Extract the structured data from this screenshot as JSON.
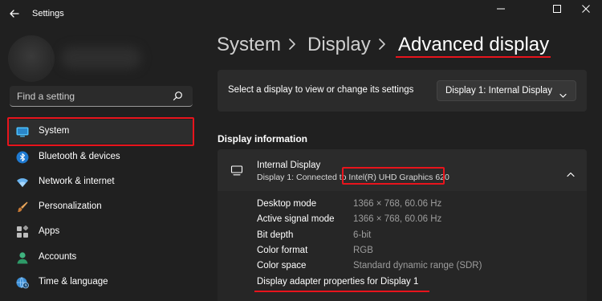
{
  "window": {
    "app_title": "Settings"
  },
  "sidebar": {
    "search_placeholder": "Find a setting",
    "items": [
      {
        "label": "System",
        "icon": "system-icon",
        "selected": true
      },
      {
        "label": "Bluetooth & devices",
        "icon": "bluetooth-icon"
      },
      {
        "label": "Network & internet",
        "icon": "wifi-icon"
      },
      {
        "label": "Personalization",
        "icon": "brush-icon"
      },
      {
        "label": "Apps",
        "icon": "apps-icon"
      },
      {
        "label": "Accounts",
        "icon": "person-icon"
      },
      {
        "label": "Time & language",
        "icon": "globe-clock-icon"
      }
    ]
  },
  "breadcrumb": {
    "items": [
      "System",
      "Display",
      "Advanced display"
    ]
  },
  "display_select": {
    "prompt": "Select a display to view or change its settings",
    "value": "Display 1: Internal Display"
  },
  "display_info": {
    "section_title": "Display information",
    "name": "Internal Display",
    "connection_prefix": "Display 1: Connected to ",
    "adapter": "Intel(R) UHD Graphics 620",
    "properties": [
      {
        "label": "Desktop mode",
        "value": "1366 × 768, 60.06 Hz"
      },
      {
        "label": "Active signal mode",
        "value": "1366 × 768, 60.06 Hz"
      },
      {
        "label": "Bit depth",
        "value": "6-bit"
      },
      {
        "label": "Color format",
        "value": "RGB"
      },
      {
        "label": "Color space",
        "value": "Standard dynamic range (SDR)"
      }
    ],
    "adapter_link": "Display adapter properties for Display 1"
  },
  "colors": {
    "background": "#202020",
    "card": "#2b2b2b",
    "accent": "#4cc2ff",
    "annotation": "#e8141c"
  }
}
